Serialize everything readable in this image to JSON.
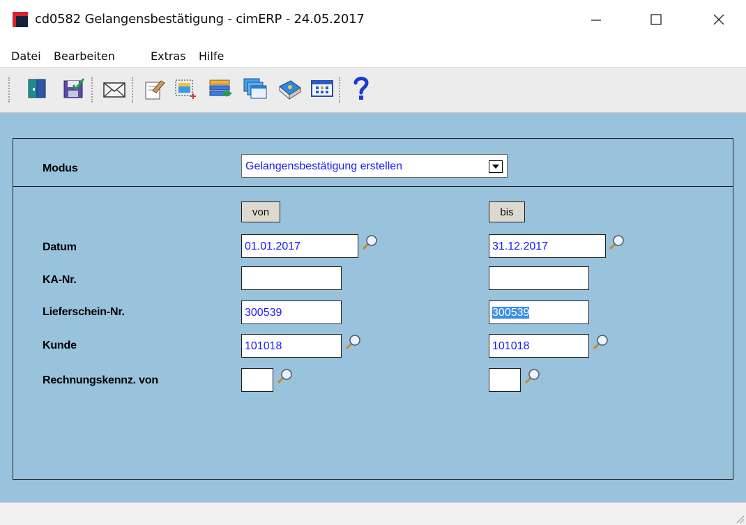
{
  "window": {
    "title": "cd0582 Gelangensbestätigung - cimERP - 24.05.2017"
  },
  "menu": [
    "Datei",
    "Bearbeiten",
    "Extras",
    "Hilfe"
  ],
  "toolbar_icons": [
    "exit-door-icon",
    "save-icon",
    "mail-icon",
    "edit-icon",
    "new-record-icon",
    "transfer-icon",
    "windows-icon",
    "book-icon",
    "table-icon",
    "help-icon"
  ],
  "form": {
    "modus_label": "Modus",
    "modus_value": "Gelangensbestätigung erstellen",
    "col_from": "von",
    "col_to": "bis",
    "rows": {
      "datum": {
        "label": "Datum",
        "from": "01.01.2017",
        "to": "31.12.2017"
      },
      "ka_nr": {
        "label": "KA-Nr.",
        "from": "",
        "to": ""
      },
      "lieferschein": {
        "label": "Lieferschein-Nr.",
        "from": "300539",
        "to": "300539"
      },
      "kunde": {
        "label": "Kunde",
        "from": "101018",
        "to": "101018"
      },
      "rechnungskennz": {
        "label": "Rechnungskennz. von",
        "from": "",
        "to": ""
      }
    }
  },
  "colors": {
    "background": "#99c2dd",
    "input_text": "#1a1aff",
    "selection": "#3a8fe8"
  }
}
